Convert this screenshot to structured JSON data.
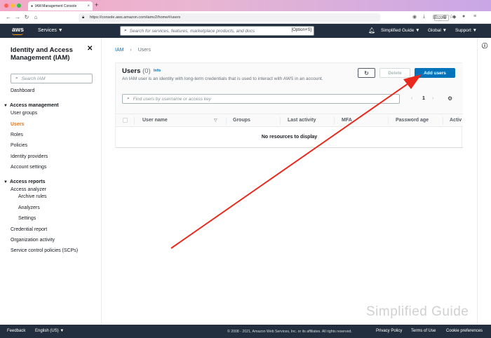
{
  "browser": {
    "tab_title": "IAM Management Console",
    "url": "https://console.aws.amazon.com/iamv2/home#/users",
    "zoom": "133%"
  },
  "aws_nav": {
    "logo": "aws",
    "services_label": "Services",
    "search_placeholder": "Search for services, features, marketplace products, and docs",
    "search_shortcut": "[Option+S]",
    "user_label": "Simplified Guide",
    "region_label": "Global",
    "support_label": "Support"
  },
  "sidebar": {
    "title": "Identity and Access Management (IAM)",
    "search_placeholder": "Search IAM",
    "dashboard": "Dashboard",
    "access_management": {
      "label": "Access management",
      "items": [
        "User groups",
        "Users",
        "Roles",
        "Policies",
        "Identity providers",
        "Account settings"
      ],
      "active": "Users"
    },
    "access_reports": {
      "label": "Access reports",
      "items": [
        "Access analyzer",
        "Archive rules",
        "Analyzers",
        "Settings",
        "Credential report",
        "Organization activity",
        "Service control policies (SCPs)"
      ]
    }
  },
  "main": {
    "breadcrumb": [
      "IAM",
      "Users"
    ],
    "panel_title": "Users",
    "panel_count": "(0)",
    "info_link": "Info",
    "description": "An IAM user is an identity with long-term credentials that is used to interact with AWS in an account.",
    "delete_label": "Delete",
    "add_users_label": "Add users",
    "table_search_placeholder": "Find users by username or access key",
    "page_number": "1",
    "columns": [
      "User name",
      "Groups",
      "Last activity",
      "MFA",
      "Password age",
      "Activ"
    ],
    "empty_message": "No resources to display"
  },
  "footer": {
    "feedback": "Feedback",
    "language": "English (US)",
    "copyright": "© 2008 - 2021, Amazon Web Services, Inc. or its affiliates. All rights reserved.",
    "privacy": "Privacy Policy",
    "terms": "Terms of Use",
    "cookies": "Cookie preferences"
  },
  "watermark": "Simplified Guide",
  "colors": {
    "aws_nav": "#232f3e",
    "primary_button": "#0073bb",
    "active_nav": "#ec7211",
    "annotation_arrow": "#e8291c"
  }
}
